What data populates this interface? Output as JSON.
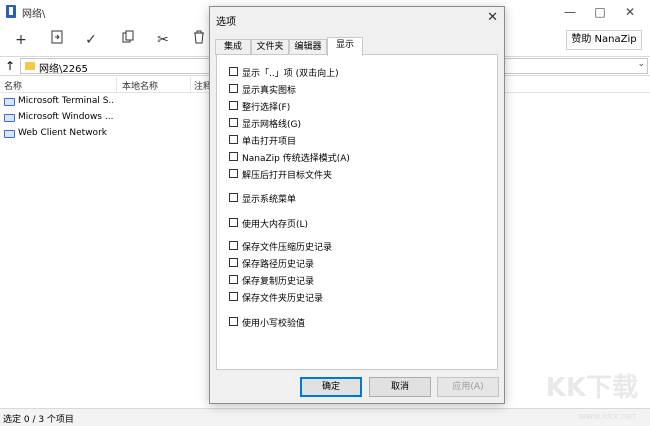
{
  "window": {
    "title": "网络\\",
    "donate_label": "赞助 NanaZip",
    "toolbar_icons": [
      "add-icon",
      "extract-icon",
      "test-icon",
      "copy-icon",
      "move-icon",
      "delete-icon"
    ]
  },
  "address": {
    "path": "网络\\2265"
  },
  "list": {
    "headers": [
      "名称",
      "本地名称",
      "注释"
    ],
    "items": [
      "Microsoft Terminal S...",
      "Microsoft Windows ...",
      "Web Client Network"
    ]
  },
  "status": {
    "text": "选定 0 / 3 个项目"
  },
  "watermark": {
    "logo": "KK下载",
    "url": "www.kkx.net"
  },
  "dialog": {
    "title": "选项",
    "tabs": [
      "集成",
      "文件夹",
      "编辑器",
      "显示"
    ],
    "active_tab": "显示",
    "options": [
      "显示「..」项 (双击向上)",
      "显示真实图标",
      "整行选择(F)",
      "显示网格线(G)",
      "单击打开项目",
      "NanaZip 传统选择模式(A)",
      "解压后打开目标文件夹",
      "显示系统菜单",
      "使用大内存页(L)",
      "保存文件压缩历史记录",
      "保存路径历史记录",
      "保存复制历史记录",
      "保存文件夹历史记录",
      "使用小写校验值"
    ],
    "buttons": {
      "ok": "确定",
      "cancel": "取消",
      "apply": "应用(A)"
    }
  }
}
